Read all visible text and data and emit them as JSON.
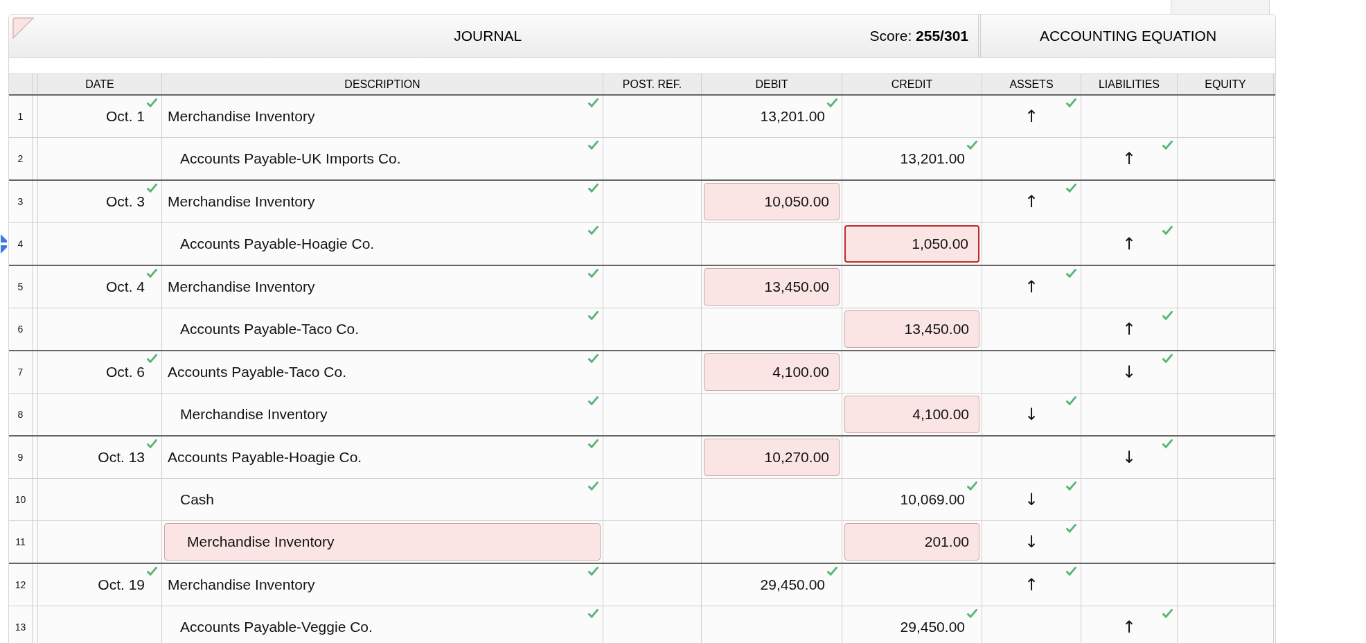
{
  "header": {
    "title": "JOURNAL",
    "score_label": "Score:",
    "score_value": "255/301",
    "equation_title": "ACCOUNTING EQUATION"
  },
  "columns": [
    "DATE",
    "DESCRIPTION",
    "POST. REF.",
    "DEBIT",
    "CREDIT",
    "ASSETS",
    "LIABILITIES",
    "EQUITY"
  ],
  "rows": [
    {
      "number": "1",
      "date": {
        "text": "Oct. 1",
        "check": true
      },
      "description": {
        "text": "Merchandise Inventory",
        "indent": false,
        "check": true,
        "highlighted": false,
        "error": false
      },
      "debit": {
        "text": "13,201.00",
        "check": true,
        "highlighted": false,
        "error": false
      },
      "assets": {
        "text": "↑",
        "check": true
      }
    },
    {
      "number": "2",
      "description": {
        "text": "Accounts Payable-UK Imports Co.",
        "indent": true,
        "check": true,
        "highlighted": false,
        "error": false
      },
      "credit": {
        "text": "13,201.00",
        "check": true,
        "highlighted": false,
        "error": false
      },
      "liabilities": {
        "text": "↑",
        "check": true
      }
    },
    {
      "number": "3",
      "date": {
        "text": "Oct. 3",
        "check": true
      },
      "description": {
        "text": "Merchandise Inventory",
        "indent": false,
        "check": true,
        "highlighted": false,
        "error": false
      },
      "debit": {
        "text": "10,050.00",
        "check": false,
        "highlighted": true,
        "error": false
      },
      "assets": {
        "text": "↑",
        "check": true
      }
    },
    {
      "number": "4",
      "handle": true,
      "description": {
        "text": "Accounts Payable-Hoagie Co.",
        "indent": true,
        "check": true,
        "highlighted": false,
        "error": false
      },
      "credit": {
        "text": "1,050.00",
        "check": false,
        "highlighted": true,
        "error": true
      },
      "liabilities": {
        "text": "↑",
        "check": true
      }
    },
    {
      "number": "5",
      "date": {
        "text": "Oct. 4",
        "check": true
      },
      "description": {
        "text": "Merchandise Inventory",
        "indent": false,
        "check": true,
        "highlighted": false,
        "error": false
      },
      "debit": {
        "text": "13,450.00",
        "check": false,
        "highlighted": true,
        "error": false
      },
      "assets": {
        "text": "↑",
        "check": true
      }
    },
    {
      "number": "6",
      "description": {
        "text": "Accounts Payable-Taco Co.",
        "indent": true,
        "check": true,
        "highlighted": false,
        "error": false
      },
      "credit": {
        "text": "13,450.00",
        "check": false,
        "highlighted": true,
        "error": false
      },
      "liabilities": {
        "text": "↑",
        "check": true
      }
    },
    {
      "number": "7",
      "date": {
        "text": "Oct. 6",
        "check": true
      },
      "description": {
        "text": "Accounts Payable-Taco Co.",
        "indent": false,
        "check": true,
        "highlighted": false,
        "error": false
      },
      "debit": {
        "text": "4,100.00",
        "check": false,
        "highlighted": true,
        "error": false
      },
      "liabilities": {
        "text": "↓",
        "check": true
      }
    },
    {
      "number": "8",
      "description": {
        "text": "Merchandise Inventory",
        "indent": true,
        "check": true,
        "highlighted": false,
        "error": false
      },
      "credit": {
        "text": "4,100.00",
        "check": false,
        "highlighted": true,
        "error": false
      },
      "assets": {
        "text": "↓",
        "check": true
      }
    },
    {
      "number": "9",
      "date": {
        "text": "Oct. 13",
        "check": true
      },
      "description": {
        "text": "Accounts Payable-Hoagie Co.",
        "indent": false,
        "check": true,
        "highlighted": false,
        "error": false
      },
      "debit": {
        "text": "10,270.00",
        "check": false,
        "highlighted": true,
        "error": false
      },
      "liabilities": {
        "text": "↓",
        "check": true
      }
    },
    {
      "number": "10",
      "description": {
        "text": "Cash",
        "indent": true,
        "check": true,
        "highlighted": false,
        "error": false
      },
      "credit": {
        "text": "10,069.00",
        "check": true,
        "highlighted": false,
        "error": false
      },
      "assets": {
        "text": "↓",
        "check": true
      }
    },
    {
      "number": "11",
      "description": {
        "text": "Merchandise Inventory",
        "indent": true,
        "check": false,
        "highlighted": true,
        "error": false
      },
      "credit": {
        "text": "201.00",
        "check": false,
        "highlighted": true,
        "error": false
      },
      "assets": {
        "text": "↓",
        "check": true
      }
    },
    {
      "number": "12",
      "date": {
        "text": "Oct. 19",
        "check": true
      },
      "description": {
        "text": "Merchandise Inventory",
        "indent": false,
        "check": true,
        "highlighted": false,
        "error": false
      },
      "debit": {
        "text": "29,450.00",
        "check": true,
        "highlighted": false,
        "error": false
      },
      "assets": {
        "text": "↑",
        "check": true
      }
    },
    {
      "number": "13",
      "description": {
        "text": "Accounts Payable-Veggie Co.",
        "indent": true,
        "check": true,
        "highlighted": false,
        "error": false
      },
      "credit": {
        "text": "29,450.00",
        "check": true,
        "highlighted": false,
        "error": false
      },
      "liabilities": {
        "text": "↑",
        "check": true
      }
    }
  ]
}
